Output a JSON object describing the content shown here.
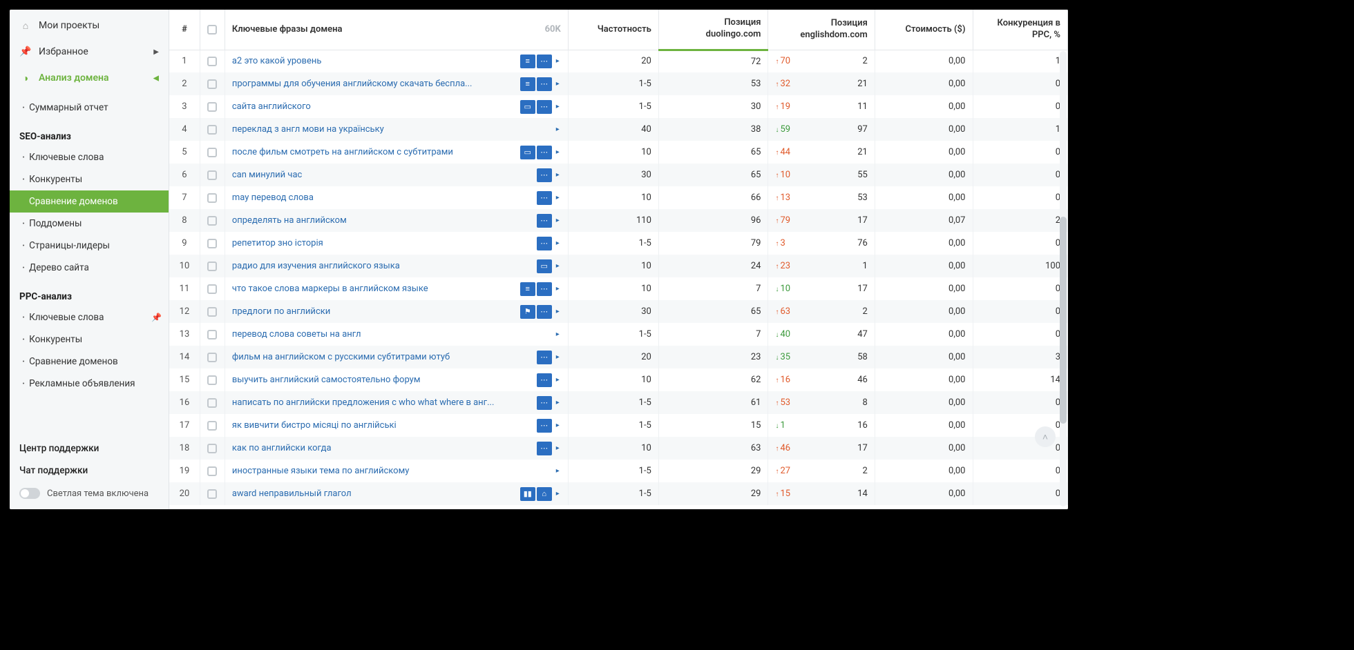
{
  "sidebar": {
    "top": [
      {
        "icon": "home-icon",
        "label": "Мои проекты",
        "key": "my-projects"
      },
      {
        "icon": "pin-icon",
        "label": "Избранное",
        "key": "favorites",
        "chevron": true
      },
      {
        "icon": "analysis-icon",
        "label": "Анализ домена",
        "key": "domain-analysis",
        "green": true,
        "chevron": true
      }
    ],
    "sections": [
      {
        "heading": null,
        "items": [
          {
            "label": "Суммарный отчет"
          }
        ]
      },
      {
        "heading": "SEO-анализ",
        "items": [
          {
            "label": "Ключевые слова"
          },
          {
            "label": "Конкуренты"
          },
          {
            "label": "Сравнение доменов",
            "active": true
          },
          {
            "label": "Поддомены"
          },
          {
            "label": "Страницы-лидеры"
          },
          {
            "label": "Дерево сайта"
          }
        ]
      },
      {
        "heading": "PPC-анализ",
        "items": [
          {
            "label": "Ключевые слова",
            "pin": true
          },
          {
            "label": "Конкуренты"
          },
          {
            "label": "Сравнение доменов"
          },
          {
            "label": "Рекламные объявления"
          }
        ]
      }
    ],
    "bottom": [
      {
        "label": "Центр поддержки"
      },
      {
        "label": "Чат поддержки"
      }
    ],
    "theme_label": "Светлая тема включена"
  },
  "table": {
    "headers": {
      "num": "#",
      "keywords": "Ключевые фразы домена",
      "keywords_count": "60K",
      "freq": "Частотность",
      "pos1_line1": "Позиция",
      "pos1_line2": "duolingo.com",
      "pos2_line1": "Позиция",
      "pos2_line2": "englishdom.com",
      "cost": "Стоимость ($)",
      "comp_line1": "Конкуренция в",
      "comp_line2": "PPC, %"
    },
    "rows": [
      {
        "n": 1,
        "kw": "а2 это какой уровень",
        "badges": [
          "lines",
          "dots"
        ],
        "freq": "20",
        "pos1": 72,
        "delta": {
          "dir": "up",
          "v": 70
        },
        "pos2": 2,
        "cost": "0,00",
        "comp": 1
      },
      {
        "n": 2,
        "kw": "программы для обучения английскому скачать беспла...",
        "badges": [
          "lines",
          "dots"
        ],
        "freq": "1-5",
        "pos1": 53,
        "delta": {
          "dir": "up",
          "v": 32
        },
        "pos2": 21,
        "cost": "0,00",
        "comp": 0
      },
      {
        "n": 3,
        "kw": "сайта английского",
        "badges": [
          "img",
          "dots"
        ],
        "freq": "1-5",
        "pos1": 30,
        "delta": {
          "dir": "up",
          "v": 19
        },
        "pos2": 11,
        "cost": "0,00",
        "comp": 0
      },
      {
        "n": 4,
        "kw": "переклад з англ мови на українську",
        "badges": [],
        "freq": "40",
        "pos1": 38,
        "delta": {
          "dir": "down",
          "v": 59
        },
        "pos2": 97,
        "cost": "0,00",
        "comp": 1
      },
      {
        "n": 5,
        "kw": "после фильм смотреть на английском с субтитрами",
        "badges": [
          "img",
          "dots"
        ],
        "freq": "10",
        "pos1": 65,
        "delta": {
          "dir": "up",
          "v": 44
        },
        "pos2": 21,
        "cost": "0,00",
        "comp": 0
      },
      {
        "n": 6,
        "kw": "can минулий час",
        "badges": [
          "dots"
        ],
        "freq": "30",
        "pos1": 65,
        "delta": {
          "dir": "up",
          "v": 10
        },
        "pos2": 55,
        "cost": "0,00",
        "comp": 0
      },
      {
        "n": 7,
        "kw": "may перевод слова",
        "badges": [
          "dots"
        ],
        "freq": "10",
        "pos1": 66,
        "delta": {
          "dir": "up",
          "v": 13
        },
        "pos2": 53,
        "cost": "0,00",
        "comp": 0
      },
      {
        "n": 8,
        "kw": "определять на английском",
        "badges": [
          "dots"
        ],
        "freq": "110",
        "pos1": 96,
        "delta": {
          "dir": "up",
          "v": 79
        },
        "pos2": 17,
        "cost": "0,07",
        "comp": 2
      },
      {
        "n": 9,
        "kw": "репетитор зно історія",
        "badges": [
          "dots"
        ],
        "freq": "1-5",
        "pos1": 79,
        "delta": {
          "dir": "up",
          "v": 3
        },
        "pos2": 76,
        "cost": "0,00",
        "comp": 0
      },
      {
        "n": 10,
        "kw": "радио для изучения английского языка",
        "badges": [
          "img"
        ],
        "freq": "10",
        "pos1": 24,
        "delta": {
          "dir": "up",
          "v": 23
        },
        "pos2": 1,
        "cost": "0,00",
        "comp": 100
      },
      {
        "n": 11,
        "kw": "что такое слова маркеры в английском языке",
        "badges": [
          "lines",
          "dots"
        ],
        "freq": "10",
        "pos1": 7,
        "delta": {
          "dir": "down",
          "v": 10
        },
        "pos2": 17,
        "cost": "0,00",
        "comp": 0
      },
      {
        "n": 12,
        "kw": "предлоги по английски",
        "badges": [
          "flag",
          "dots"
        ],
        "freq": "30",
        "pos1": 65,
        "delta": {
          "dir": "up",
          "v": 63
        },
        "pos2": 2,
        "cost": "0,00",
        "comp": 0
      },
      {
        "n": 13,
        "kw": "перевод слова советы на англ",
        "badges": [],
        "freq": "1-5",
        "pos1": 7,
        "delta": {
          "dir": "down",
          "v": 40
        },
        "pos2": 47,
        "cost": "0,00",
        "comp": 0
      },
      {
        "n": 14,
        "kw": "фильм на английском с русскими субтитрами ютуб",
        "badges": [
          "dots"
        ],
        "freq": "20",
        "pos1": 23,
        "delta": {
          "dir": "down",
          "v": 35
        },
        "pos2": 58,
        "cost": "0,00",
        "comp": 3
      },
      {
        "n": 15,
        "kw": "выучить английский самостоятельно форум",
        "badges": [
          "dots"
        ],
        "freq": "10",
        "pos1": 62,
        "delta": {
          "dir": "up",
          "v": 16
        },
        "pos2": 46,
        "cost": "0,00",
        "comp": 14
      },
      {
        "n": 16,
        "kw": "написать по английски предложения с who what where в анг...",
        "badges": [
          "dots"
        ],
        "freq": "1-5",
        "pos1": 61,
        "delta": {
          "dir": "up",
          "v": 53
        },
        "pos2": 8,
        "cost": "0,00",
        "comp": 0
      },
      {
        "n": 17,
        "kw": "як вивчити бистро місяці по англійські",
        "badges": [
          "dots"
        ],
        "freq": "1-5",
        "pos1": 15,
        "delta": {
          "dir": "down",
          "v": 1
        },
        "pos2": 16,
        "cost": "0,00",
        "comp": 0
      },
      {
        "n": 18,
        "kw": "как по английски когда",
        "badges": [
          "dots"
        ],
        "freq": "10",
        "pos1": 63,
        "delta": {
          "dir": "up",
          "v": 46
        },
        "pos2": 17,
        "cost": "0,00",
        "comp": 0
      },
      {
        "n": 19,
        "kw": "иностранные языки тема по английскому",
        "badges": [],
        "freq": "1-5",
        "pos1": 29,
        "delta": {
          "dir": "up",
          "v": 27
        },
        "pos2": 2,
        "cost": "0,00",
        "comp": 0
      },
      {
        "n": 20,
        "kw": "award неправильный глагол",
        "badges": [
          "bars",
          "cam"
        ],
        "freq": "1-5",
        "pos1": 29,
        "delta": {
          "dir": "up",
          "v": 15
        },
        "pos2": 14,
        "cost": "0,00",
        "comp": 0
      }
    ]
  },
  "badge_glyphs": {
    "lines": "≡",
    "dots": "⋯",
    "img": "▭",
    "flag": "⚑",
    "bars": "▮▮",
    "cam": "⌂"
  }
}
